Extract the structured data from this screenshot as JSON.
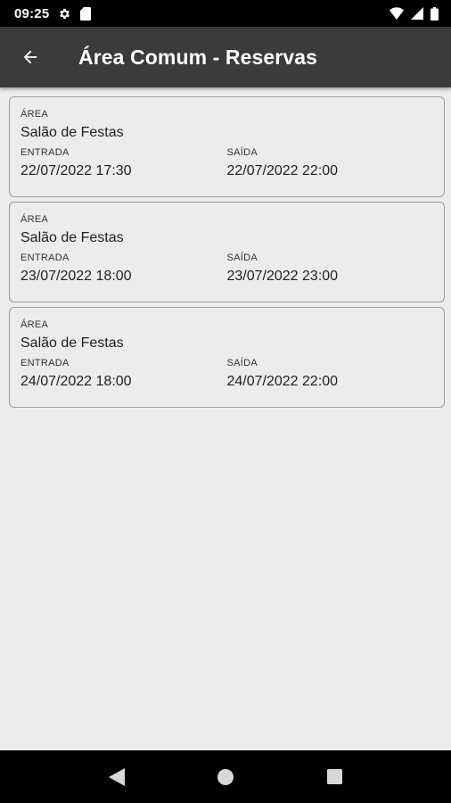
{
  "status_bar": {
    "time": "09:25",
    "icons": [
      "gear-icon",
      "sd-card-icon",
      "wifi-icon",
      "signal-icon",
      "battery-icon"
    ]
  },
  "app_bar": {
    "back_icon": "arrow-back-icon",
    "title": "Área Comum - Reservas"
  },
  "labels": {
    "area": "ÁREA",
    "entrada": "ENTRADA",
    "saida": "SAÍDA"
  },
  "reservations": [
    {
      "area": "Salão de Festas",
      "entrada": "22/07/2022 17:30",
      "saida": "22/07/2022 22:00"
    },
    {
      "area": "Salão de Festas",
      "entrada": "23/07/2022 18:00",
      "saida": "23/07/2022 23:00"
    },
    {
      "area": "Salão de Festas",
      "entrada": "24/07/2022 18:00",
      "saida": "24/07/2022 22:00"
    }
  ],
  "nav_bar": {
    "icons": [
      "back-triangle-icon",
      "home-circle-icon",
      "recents-square-icon"
    ]
  },
  "colors": {
    "status_bar": "#000000",
    "app_bar": "#3b3b3b",
    "background": "#ececec",
    "card_border": "#9d9d9d"
  }
}
